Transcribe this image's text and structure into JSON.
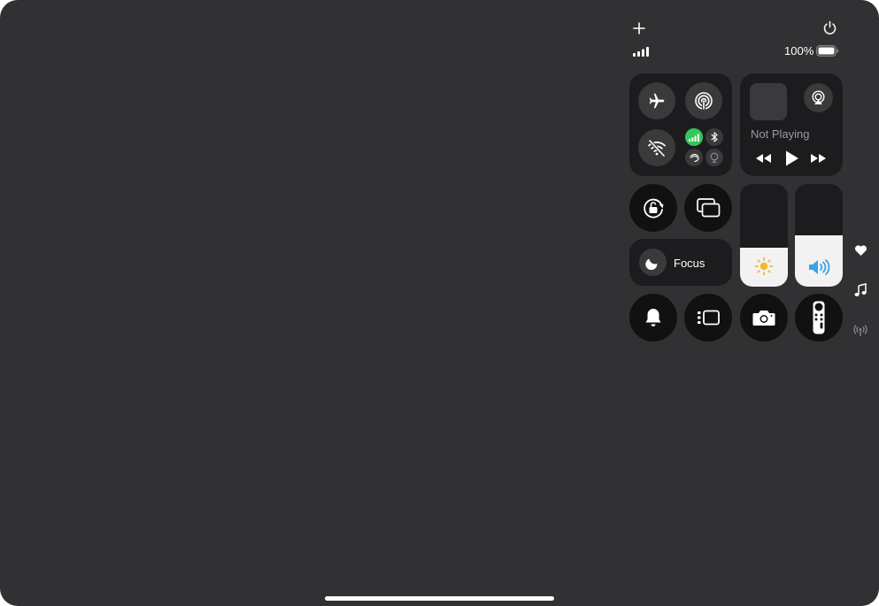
{
  "status": {
    "battery_text": "100%"
  },
  "connectivity": {
    "airplane_mode": "off",
    "airdrop": "on",
    "wifi": "off",
    "cellular": "on",
    "bluetooth": "off",
    "personal_hotspot": "off",
    "vpn": "off"
  },
  "media": {
    "now_playing": "Not Playing"
  },
  "focus": {
    "label": "Focus"
  },
  "sliders": {
    "brightness_level": 0.38,
    "volume_level": 0.5
  },
  "colors": {
    "cellular_active": "#34c759",
    "brightness_icon": "#f7b731",
    "volume_icon": "#3aa3e3"
  }
}
